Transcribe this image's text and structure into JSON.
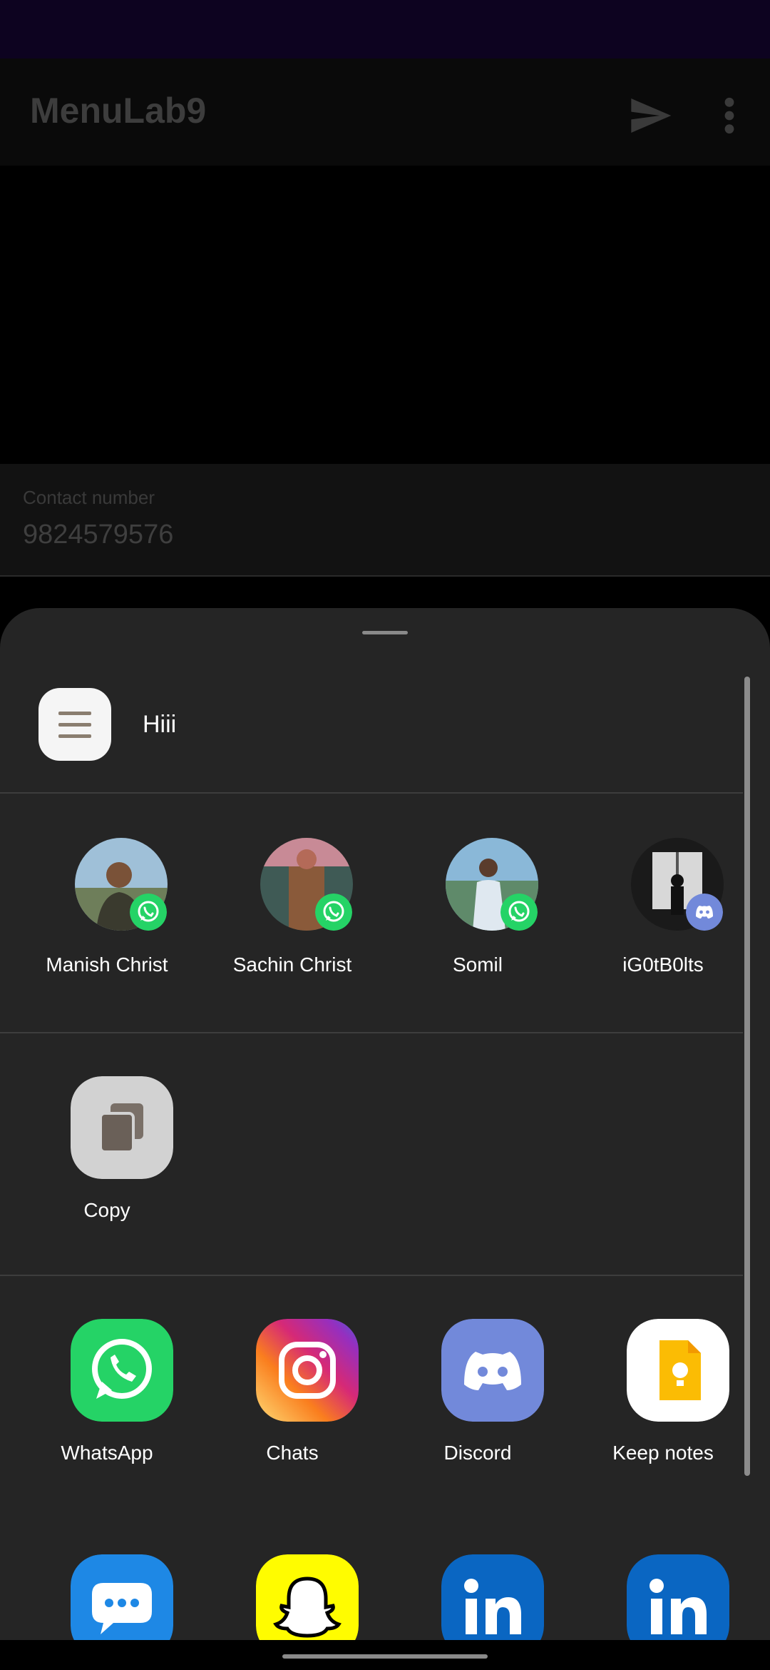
{
  "app": {
    "title": "MenuLab9"
  },
  "contact": {
    "label": "Contact number",
    "value": "9824579576"
  },
  "share": {
    "preview_text": "Hiii",
    "direct_targets": [
      {
        "name": "Manish Christ",
        "badge": "whatsapp-icon"
      },
      {
        "name": "Sachin Christ",
        "badge": "whatsapp-icon"
      },
      {
        "name": "Somil",
        "badge": "whatsapp-icon"
      },
      {
        "name": "iG0tB0lts",
        "badge": "discord-icon"
      }
    ],
    "copy_label": "Copy",
    "apps": [
      {
        "label": "WhatsApp",
        "icon": "whatsapp-icon"
      },
      {
        "label": "Chats",
        "icon": "instagram-icon"
      },
      {
        "label": "Discord",
        "icon": "discord-icon"
      },
      {
        "label": "Keep notes",
        "icon": "keep-notes-icon"
      }
    ],
    "more_apps": [
      {
        "icon": "messages-icon"
      },
      {
        "icon": "snapchat-icon"
      },
      {
        "icon": "linkedin-icon"
      },
      {
        "icon": "linkedin-icon"
      }
    ]
  },
  "colors": {
    "status_bar": "#0d0320",
    "sheet_bg": "#252525",
    "whatsapp": "#25d366",
    "discord": "#7289da",
    "keep": "#fbbc04",
    "linkedin": "#0a66c2",
    "snapchat": "#fffc00",
    "messages": "#1e88e5"
  }
}
